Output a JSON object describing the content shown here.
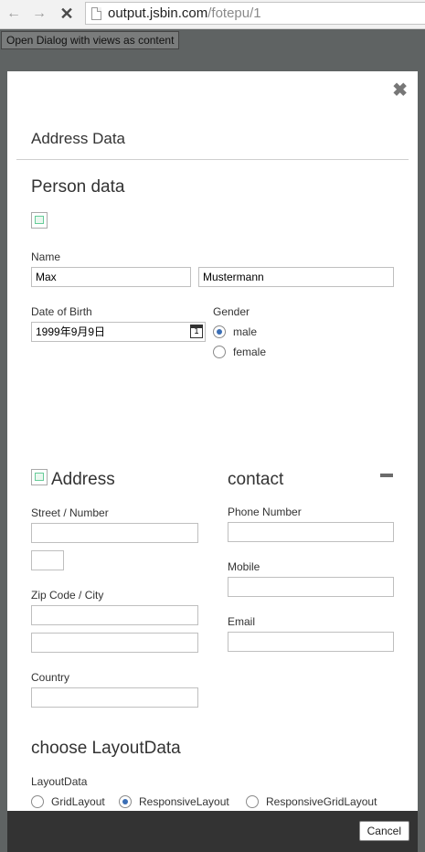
{
  "browser": {
    "back_icon": "←",
    "forward_icon": "→",
    "stop_icon": "✕",
    "url_host": "output.jsbin.com",
    "url_path": "/fotepu/1"
  },
  "page": {
    "open_dialog_label": "Open Dialog with views as content"
  },
  "dialog": {
    "close_icon": "✖",
    "title": "Address Data",
    "person": {
      "heading": "Person data",
      "name_label": "Name",
      "first_name": "Max",
      "last_name": "Mustermann",
      "dob_label": "Date of Birth",
      "dob_value": "1999年9月9日",
      "calendar_day": "1",
      "gender_label": "Gender",
      "gender_options": [
        "male",
        "female"
      ],
      "gender_selected": "male"
    },
    "address": {
      "heading": "Address",
      "street_label": "Street / Number",
      "zip_label": "Zip Code / City",
      "country_label": "Country"
    },
    "contact": {
      "heading": "contact",
      "phone_label": "Phone Number",
      "mobile_label": "Mobile",
      "email_label": "Email"
    },
    "layout": {
      "heading": "choose LayoutData",
      "label": "LayoutData",
      "options": [
        "GridLayout",
        "ResponsiveLayout",
        "ResponsiveGridLayout"
      ],
      "selected": "ResponsiveLayout"
    },
    "cancel_label": "Cancel"
  }
}
